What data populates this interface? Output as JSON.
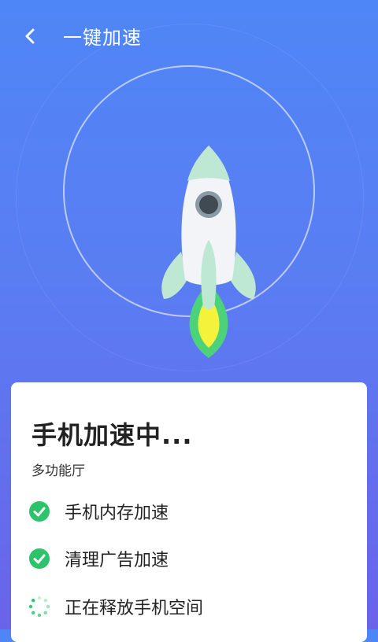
{
  "header": {
    "title": "一键加速",
    "back_icon": "back-arrow-icon"
  },
  "hero": {
    "icon": "rocket-icon",
    "colors": {
      "rocket_body": "#f2f4f7",
      "fin": "#bfe8d4",
      "flame_outer": "#4cd27a",
      "flame_inner": "#f4f23a"
    }
  },
  "card": {
    "title": "手机加速中...",
    "subtitle": "多功能厅",
    "items": [
      {
        "label": "手机内存加速",
        "status": "done",
        "icon": "check-circle-icon"
      },
      {
        "label": "清理广告加速",
        "status": "done",
        "icon": "check-circle-icon"
      },
      {
        "label": "正在释放手机空间",
        "status": "loading",
        "icon": "loading-spinner-icon"
      }
    ]
  },
  "colors": {
    "check_green": "#2cc36b",
    "bg_top": "#4f86f7",
    "bg_bottom": "#6a63ea"
  }
}
